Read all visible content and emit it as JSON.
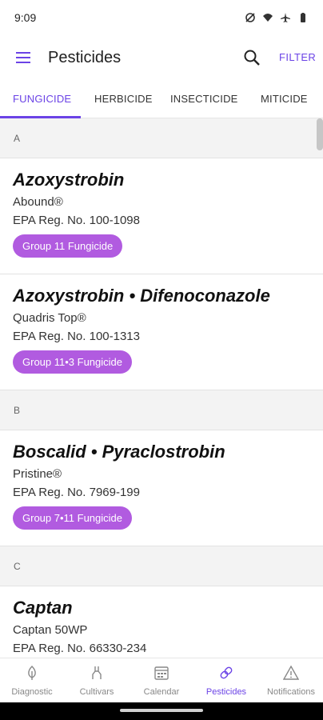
{
  "status_bar": {
    "time": "9:09"
  },
  "app_bar": {
    "title": "Pesticides",
    "filter_label": "FILTER"
  },
  "tabs": [
    {
      "label": "FUNGICIDE",
      "active": true
    },
    {
      "label": "HERBICIDE",
      "active": false
    },
    {
      "label": "INSECTICIDE",
      "active": false
    },
    {
      "label": "MITICIDE",
      "active": false
    }
  ],
  "sections": [
    {
      "letter": "A",
      "items": [
        {
          "active_ingredient": "Azoxystrobin",
          "brand": "Abound®",
          "epa": "EPA Reg. No. 100-1098",
          "group": "Group 11 Fungicide"
        },
        {
          "active_ingredient": "Azoxystrobin • Difenoconazole",
          "brand": "Quadris Top®",
          "epa": "EPA Reg. No. 100-1313",
          "group": "Group 11•3 Fungicide"
        }
      ]
    },
    {
      "letter": "B",
      "items": [
        {
          "active_ingredient": "Boscalid • Pyraclostrobin",
          "brand": "Pristine®",
          "epa": "EPA Reg. No. 7969-199",
          "group": "Group 7•11 Fungicide"
        }
      ]
    },
    {
      "letter": "C",
      "items": [
        {
          "active_ingredient": "Captan",
          "brand": "Captan 50WP",
          "epa": "EPA Reg. No. 66330-234",
          "group": ""
        }
      ]
    }
  ],
  "bottom_nav": [
    {
      "label": "Diagnostic",
      "icon": "leaf-icon",
      "active": false
    },
    {
      "label": "Cultivars",
      "icon": "plant-icon",
      "active": false
    },
    {
      "label": "Calendar",
      "icon": "calendar-icon",
      "active": false
    },
    {
      "label": "Pesticides",
      "icon": "pesticide-icon",
      "active": true
    },
    {
      "label": "Notifications",
      "icon": "warning-icon",
      "active": false
    }
  ],
  "colors": {
    "accent": "#6b43e6",
    "badge": "#b15be0"
  }
}
